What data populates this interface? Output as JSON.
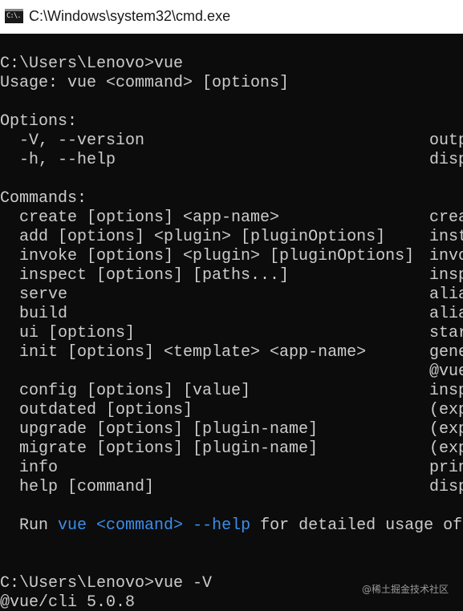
{
  "window": {
    "title": "C:\\Windows\\system32\\cmd.exe",
    "icon_label": "C:\\.",
    "icon": "console-icon"
  },
  "console": {
    "prompt1": "C:\\Users\\Lenovo>vue",
    "usage": "Usage: vue <command> [options]",
    "options_header": "Options:",
    "options": [
      {
        "flag": "  -V, --version",
        "desc": "outp"
      },
      {
        "flag": "  -h, --help",
        "desc": "disp"
      }
    ],
    "commands_header": "Commands:",
    "commands": [
      {
        "cmd": "  create [options] <app-name>",
        "desc": "crea"
      },
      {
        "cmd": "  add [options] <plugin> [pluginOptions]",
        "desc": "inst"
      },
      {
        "cmd": "  invoke [options] <plugin> [pluginOptions]",
        "desc": "invo"
      },
      {
        "cmd": "  inspect [options] [paths...]",
        "desc": "insp"
      },
      {
        "cmd": "  serve",
        "desc": "alia"
      },
      {
        "cmd": "  build",
        "desc": "alia"
      },
      {
        "cmd": "  ui [options]",
        "desc": "star"
      },
      {
        "cmd": "  init [options] <template> <app-name>",
        "desc": "gene"
      },
      {
        "cmd": "",
        "desc": "@vue"
      },
      {
        "cmd": "  config [options] [value]",
        "desc": "insp"
      },
      {
        "cmd": "  outdated [options]",
        "desc": "(exp"
      },
      {
        "cmd": "  upgrade [options] [plugin-name]",
        "desc": "(exp"
      },
      {
        "cmd": "  migrate [options] [plugin-name]",
        "desc": "(exp"
      },
      {
        "cmd": "  info",
        "desc": "prin"
      },
      {
        "cmd": "  help [command]",
        "desc": "disp"
      }
    ],
    "run_hint": {
      "prefix": "  Run ",
      "vue": "vue",
      "command": " <command>",
      "help": " --help",
      "suffix": " for detailed usage of"
    },
    "prompt2": "C:\\Users\\Lenovo>vue -V",
    "version_output": "@vue/cli 5.0.8"
  },
  "watermark": "@稀土掘金技术社区",
  "colors": {
    "background": "#0c0c0c",
    "text": "#cccccc",
    "highlight": "#3b8eea"
  }
}
